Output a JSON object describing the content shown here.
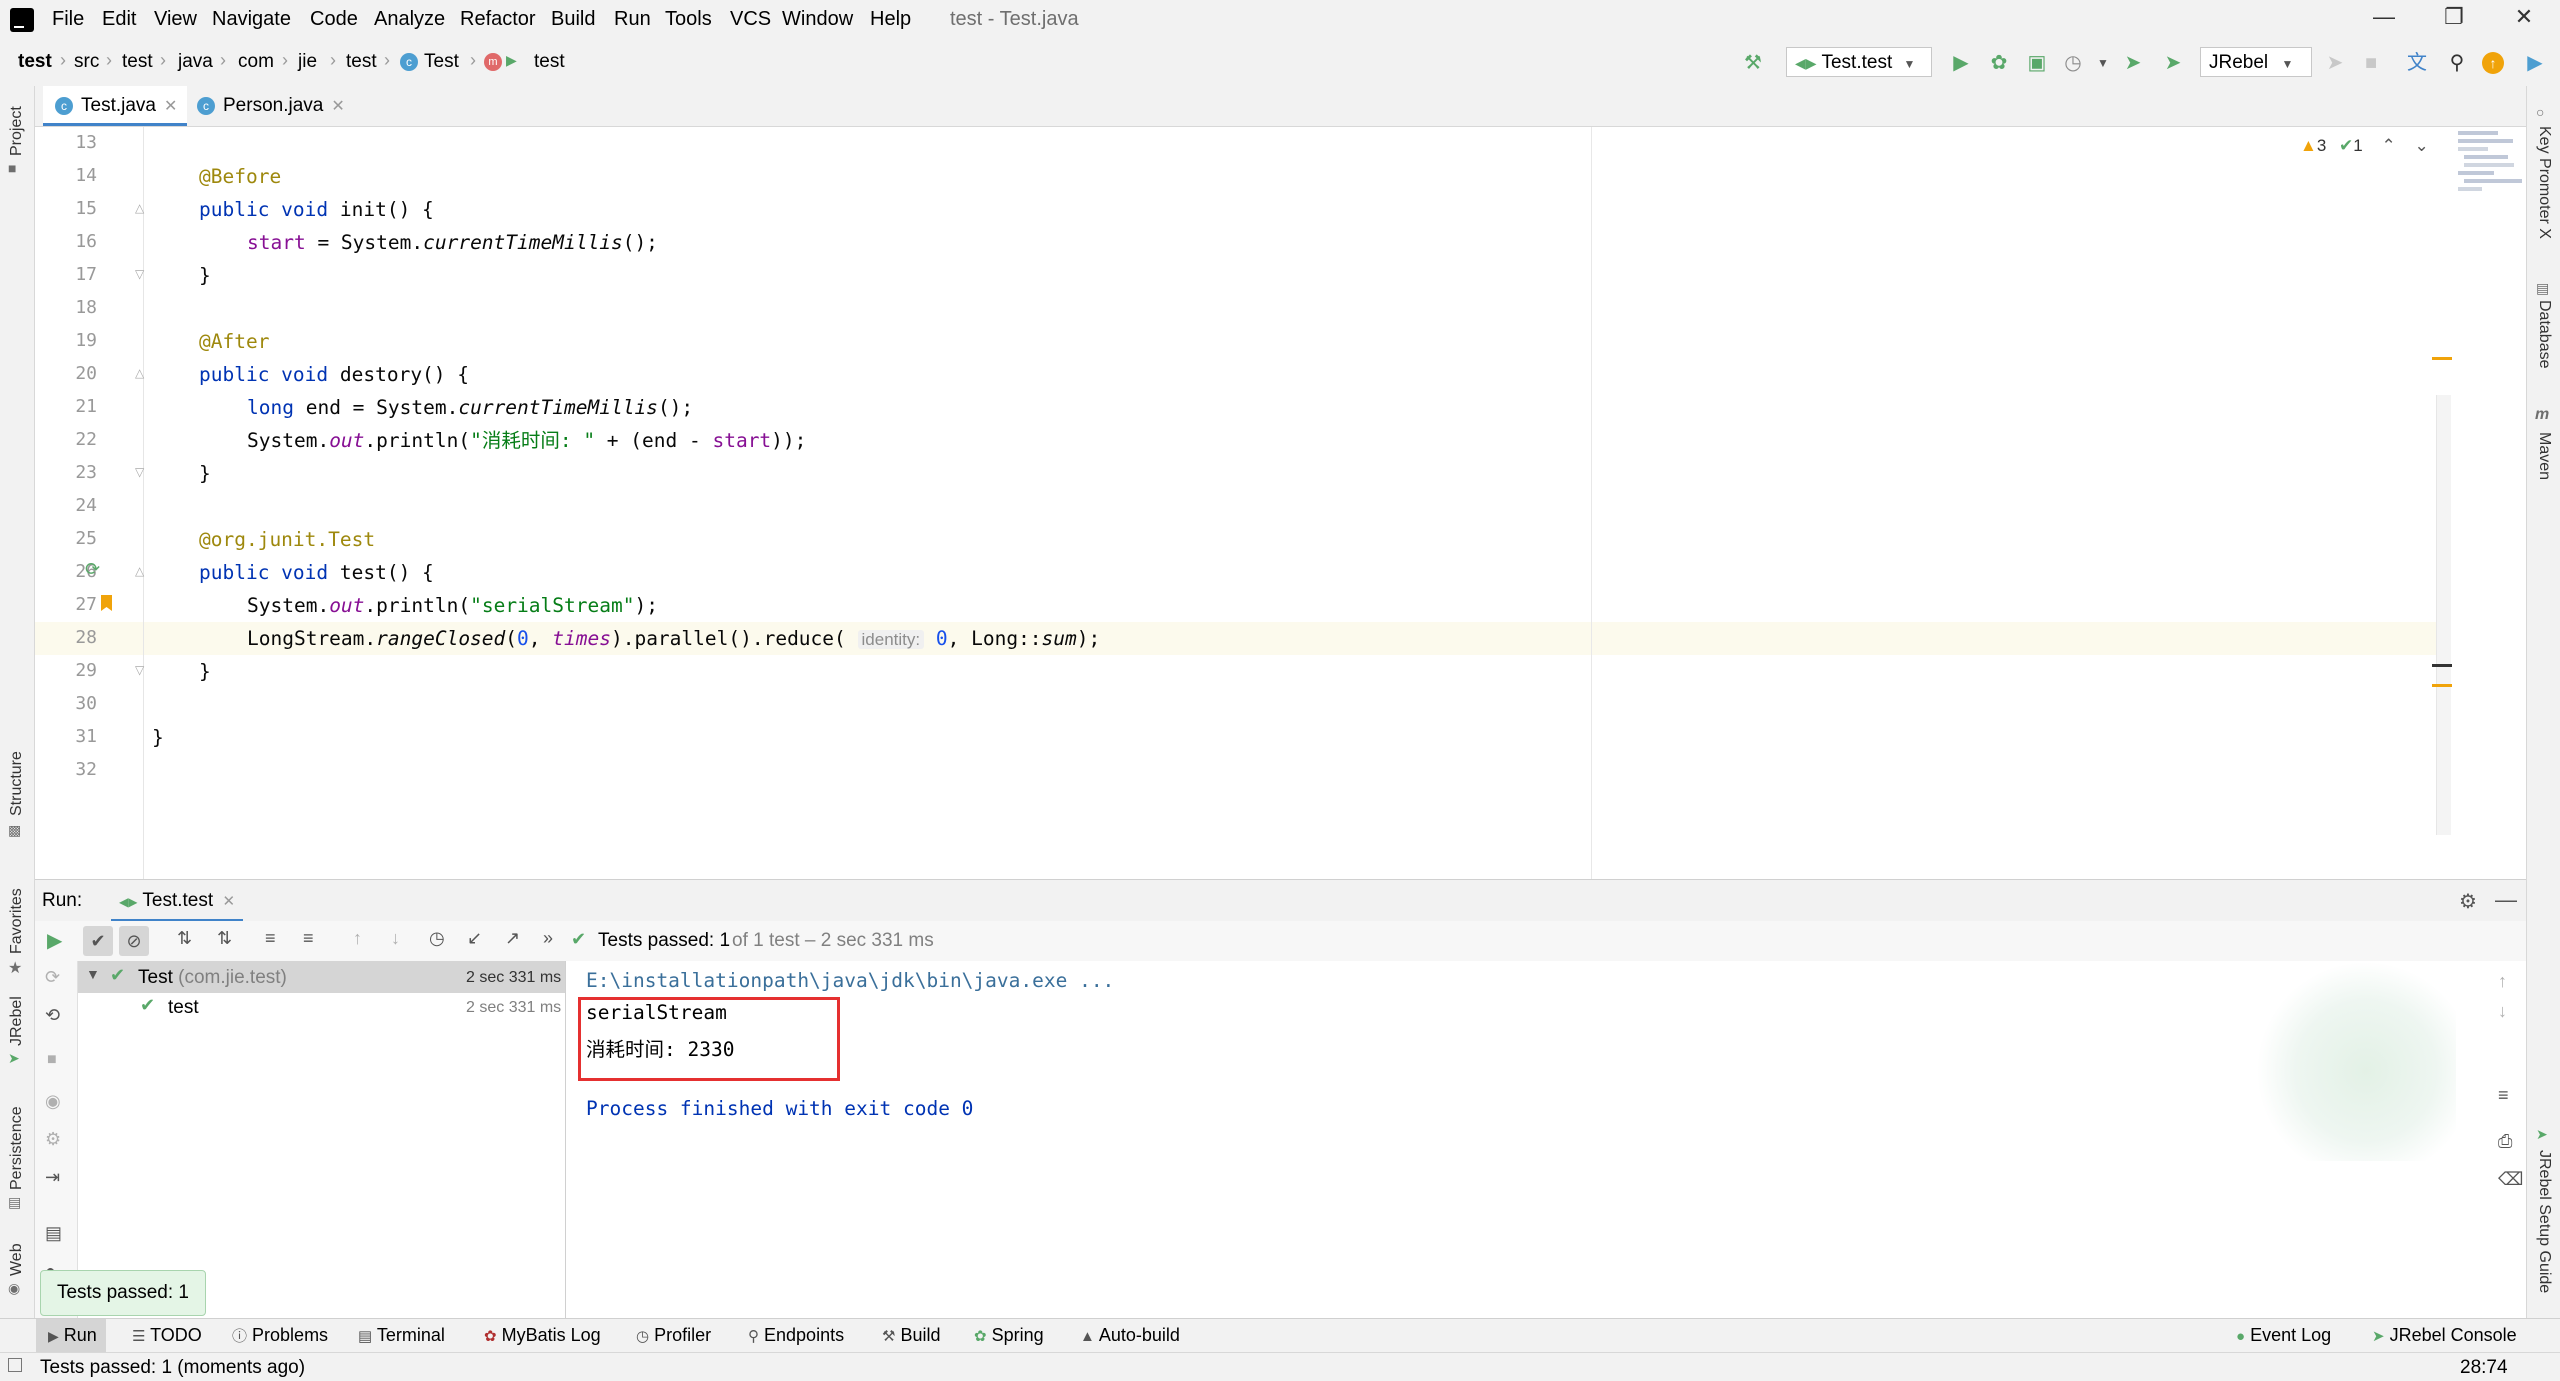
{
  "window": {
    "title": "test - Test.java",
    "menu": [
      "File",
      "Edit",
      "View",
      "Navigate",
      "Code",
      "Analyze",
      "Refactor",
      "Build",
      "Run",
      "Tools",
      "VCS",
      "Window",
      "Help"
    ]
  },
  "breadcrumb": [
    "test",
    "src",
    "test",
    "java",
    "com",
    "jie",
    "test",
    "Test",
    "test"
  ],
  "toolbar": {
    "run_config": "Test.test",
    "jrebel_label": "JRebel"
  },
  "editor": {
    "tabs": [
      {
        "label": "Test.java",
        "active": true
      },
      {
        "label": "Person.java",
        "active": false
      }
    ],
    "inspections": {
      "warnings": "3",
      "checks": "1"
    },
    "line_numbers": [
      "13",
      "14",
      "15",
      "16",
      "17",
      "18",
      "19",
      "20",
      "21",
      "22",
      "23",
      "24",
      "25",
      "26",
      "27",
      "28",
      "29",
      "30",
      "31",
      "32"
    ],
    "code": {
      "l14_ann": "@Before",
      "l15_kw": "public void",
      "l15_rest": " init() {",
      "l16_fld": "start",
      "l16_a": " = System.",
      "l16_m": "currentTimeMillis",
      "l16_b": "();",
      "l17": "}",
      "l19_ann": "@After",
      "l20_kw": "public void",
      "l20_rest": " destory() {",
      "l21_kw": "long",
      "l21_a": " end = System.",
      "l21_m": "currentTimeMillis",
      "l21_b": "();",
      "l22_a": "System.",
      "l22_f": "out",
      "l22_b": ".println(",
      "l22_s": "\"消耗时间: \"",
      "l22_c": " + (end - ",
      "l22_f2": "start",
      "l22_d": "));",
      "l23": "}",
      "l25_ann": "@org.junit.",
      "l25_ann2": "Test",
      "l26_kw": "public void",
      "l26_rest": " test() {",
      "l27_a": "System.",
      "l27_f": "out",
      "l27_b": ".println(",
      "l27_s": "\"serialStream\"",
      "l27_c": ");",
      "l28_a": "LongStream.",
      "l28_m": "rangeClosed",
      "l28_b": "(",
      "l28_n": "0",
      "l28_c": ", ",
      "l28_f": "times",
      "l28_d": ").parallel().reduce(",
      "l28_hint": "identity:",
      "l28_n2": "0",
      "l28_e": ", Long::",
      "l28_m2": "sum",
      "l28_g": ");",
      "l29": "}",
      "l31": "}"
    }
  },
  "run_panel": {
    "title": "Run:",
    "tab": "Test.test",
    "status_main": "Tests passed: 1",
    "status_detail": "of 1 test – 2 sec 331 ms",
    "tree": [
      {
        "label": "Test",
        "pkg": "(com.jie.test)",
        "time": "2 sec 331 ms"
      },
      {
        "label": "test",
        "time": "2 sec 331 ms"
      }
    ],
    "console": [
      "E:\\installationpath\\java\\jdk\\bin\\java.exe ...",
      "serialStream",
      "消耗时间: 2330",
      "",
      "Process finished with exit code 0"
    ],
    "toast": "Tests passed: 1"
  },
  "side_tools": {
    "left": [
      "Project",
      "Structure",
      "Favorites",
      "JRebel",
      "Persistence",
      "Web"
    ],
    "right": [
      "Key Promoter X",
      "Database",
      "Maven",
      "JRebel Setup Guide"
    ]
  },
  "tool_windows": [
    "Run",
    "TODO",
    "Problems",
    "Terminal",
    "MyBatis Log",
    "Profiler",
    "Endpoints",
    "Build",
    "Spring",
    "Auto-build"
  ],
  "tool_windows_right": [
    "Event Log",
    "JRebel Console"
  ],
  "status_bar": {
    "message": "Tests passed: 1 (moments ago)",
    "position": "28:74"
  },
  "colors": {
    "accent": "#4083c9",
    "run_green": "#59a869",
    "highlight_box": "#e53030",
    "warning": "#f0a30a"
  }
}
